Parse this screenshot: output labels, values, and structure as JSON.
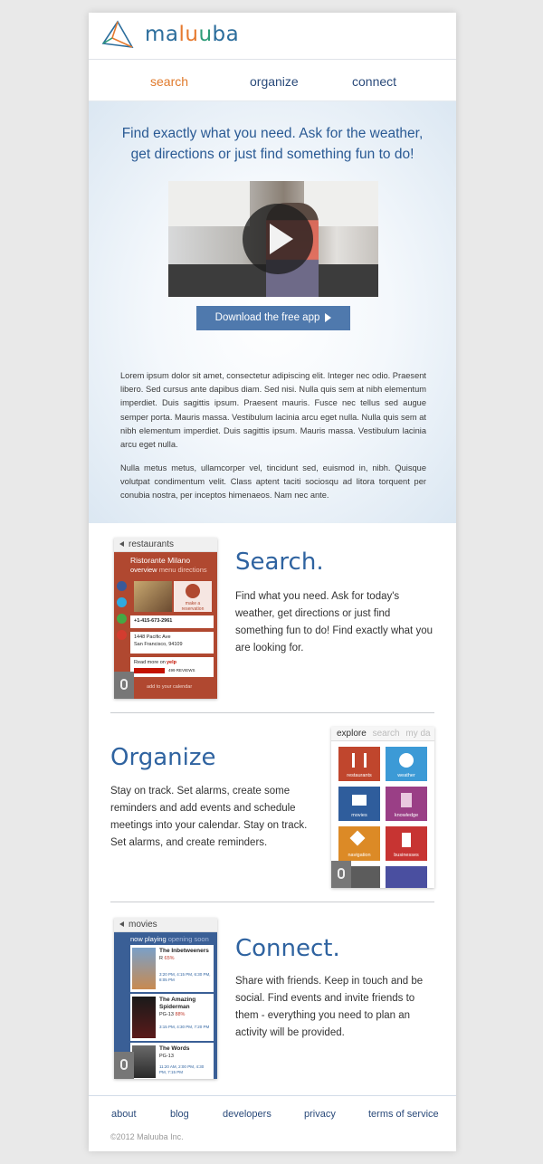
{
  "brand": {
    "name_parts": [
      "ma",
      "lu",
      "u",
      "ba"
    ]
  },
  "nav": [
    {
      "label": "search",
      "active": true
    },
    {
      "label": "organize",
      "active": false
    },
    {
      "label": "connect",
      "active": false
    }
  ],
  "hero": {
    "title_line1": "Find exactly what you need. Ask for the weather,",
    "title_line2": "get directions or just find something fun to do!",
    "download_label": "Download the free app",
    "paragraph1": "Lorem ipsum dolor sit amet, consectetur adipiscing elit. Integer nec odio. Praesent libero. Sed cursus ante dapibus diam. Sed nisi. Nulla quis sem at nibh elementum imperdiet. Duis sagittis ipsum. Praesent mauris. Fusce nec tellus sed augue semper porta. Mauris massa. Vestibulum lacinia arcu eget nulla. Nulla quis sem at nibh elementum imperdiet. Duis sagittis ipsum. Mauris massa. Vestibulum lacinia arcu eget nulla.",
    "paragraph2": "Nulla metus metus, ullamcorper vel, tincidunt sed, euismod in, nibh. Quisque volutpat condimentum velit. Class aptent taciti sociosqu ad litora torquent per conubia nostra, per inceptos himenaeos. Nam nec ante."
  },
  "search_section": {
    "title": "Search.",
    "text": "Find what you need. Ask for today's weather, get directions or just find something fun to do! Find exactly what you are looking for.",
    "phone": {
      "header": "restaurants",
      "name": "Ristorante Milano",
      "tab_active": "overview",
      "tab2": "menu",
      "tab3": "directions",
      "reserve_label": "make a reservation",
      "phone_number": "+1-415-673-2961",
      "address1": "1448 Pacific Ave",
      "address2": "San Francisco, 94109",
      "read_more": "Read more on",
      "yelp": "yelp",
      "reviews": "499 REVIEWS",
      "calendar": "add to your calendar"
    }
  },
  "organize_section": {
    "title": "Organize",
    "text": "Stay on track. Set alarms, create some reminders and add events and schedule meetings into your calendar. Stay on track. Set alarms, and create reminders.",
    "phone": {
      "tab_active": "explore",
      "tab2": "search",
      "tab3": "my da",
      "tiles": [
        {
          "label": "restaurants",
          "color": "#c0462d"
        },
        {
          "label": "weather",
          "color": "#3c9ad6"
        },
        {
          "label": "movies",
          "color": "#2f5d9c"
        },
        {
          "label": "knowledge",
          "color": "#9a3f86"
        },
        {
          "label": "navigation",
          "color": "#dc8a26"
        },
        {
          "label": "businesses",
          "color": "#c73432"
        }
      ]
    }
  },
  "connect_section": {
    "title": "Connect.",
    "text": "Share with friends. Keep in touch and be social. Find events and invite friends to them - everything you need to plan an activity will be provided.",
    "phone": {
      "header": "movies",
      "tab_active": "now playing",
      "tab2": "opening soon",
      "movies": [
        {
          "title": "The Inbetweeners",
          "rating": "R",
          "score": "65%",
          "times": "3:20 PM, 4:15 PM, 6:30 PM, 8:05 PM"
        },
        {
          "title": "The Amazing Spiderman",
          "rating": "PG-13",
          "score": "88%",
          "times": "3:15 PM, 4:30 PM, 7:20 PM"
        },
        {
          "title": "The Words",
          "rating": "PG-13",
          "score": "",
          "times": "11:20 AM, 2:00 PM, 4:30 PM, 7:15 PM"
        }
      ]
    }
  },
  "footer": {
    "links": [
      "about",
      "blog",
      "developers",
      "privacy",
      "terms of service"
    ],
    "copyright": "©2012 Maluuba Inc."
  },
  "colors": {
    "accent": "#e07a2c",
    "brand_blue": "#2f63a0",
    "button": "#4f79ad"
  }
}
